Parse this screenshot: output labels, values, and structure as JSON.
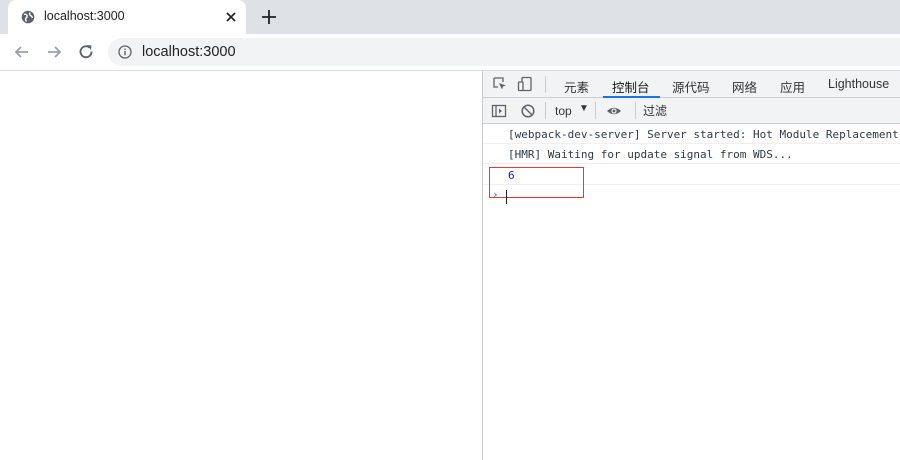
{
  "browser": {
    "tab": {
      "title": "localhost:3000"
    },
    "address_bar": {
      "url": "localhost:3000"
    }
  },
  "devtools": {
    "tabs": [
      {
        "label": "元素"
      },
      {
        "label": "控制台",
        "active": true
      },
      {
        "label": "源代码"
      },
      {
        "label": "网络"
      },
      {
        "label": "应用"
      },
      {
        "label": "Lighthouse"
      }
    ],
    "console_toolbar": {
      "context": "top",
      "filter_placeholder": "过滤"
    },
    "console": {
      "messages": [
        {
          "text": "[webpack-dev-server] Server started: Hot Module Replacement enabled, Live Reloading enabled, Progress disabled, Overlay enabled."
        },
        {
          "text": "[HMR] Waiting for update signal from WDS..."
        }
      ],
      "result": "6",
      "prompt_symbol": "›"
    }
  },
  "colors": {
    "accent": "#1a73e8",
    "highlight_box": "#e53935",
    "result_value": "#1a1aa6"
  }
}
